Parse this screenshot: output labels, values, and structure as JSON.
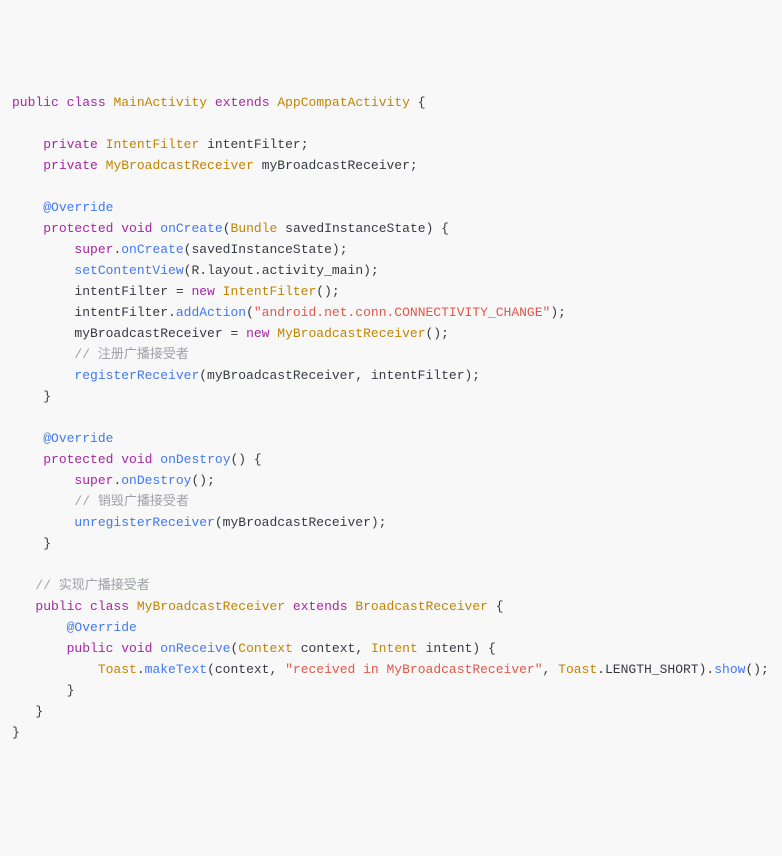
{
  "code": {
    "l01": {
      "kw1": "public",
      "kw2": "class",
      "cls": "MainActivity",
      "kw3": "extends",
      "sup": "AppCompatActivity",
      "br": "{"
    },
    "l02": "",
    "l03": {
      "kw": "private",
      "type": "IntentFilter",
      "var": "intentFilter;"
    },
    "l04": {
      "kw": "private",
      "type": "MyBroadcastReceiver",
      "var": "myBroadcastReceiver;"
    },
    "l05": "",
    "l06": {
      "ann": "@Override"
    },
    "l07": {
      "kw1": "protected",
      "kw2": "void",
      "m": "onCreate",
      "p1": "(",
      "type": "Bundle",
      "var": "savedInstanceState",
      "p2": ") {"
    },
    "l08": {
      "kw": "super",
      "dot": ".",
      "m": "onCreate",
      "rest": "(savedInstanceState);"
    },
    "l09": {
      "m": "setContentView",
      "p1": "(",
      "r": "R",
      "d1": ".",
      "lay": "layout",
      "d2": ".",
      "am": "activity_main",
      "p2": ");"
    },
    "l10": {
      "lhs": "intentFilter = ",
      "kw": "new",
      "type": "IntentFilter",
      "rest": "();"
    },
    "l11": {
      "obj": "intentFilter.",
      "m": "addAction",
      "p1": "(",
      "str": "\"android.net.conn.CONNECTIVITY_CHANGE\"",
      "p2": ");"
    },
    "l12": {
      "lhs": "myBroadcastReceiver = ",
      "kw": "new",
      "type": "MyBroadcastReceiver",
      "rest": "();"
    },
    "l13": {
      "c": "// 注册广播接受者"
    },
    "l14": {
      "m": "registerReceiver",
      "rest": "(myBroadcastReceiver, intentFilter);"
    },
    "l15": {
      "br": "}"
    },
    "l16": "",
    "l17": {
      "ann": "@Override"
    },
    "l18": {
      "kw1": "protected",
      "kw2": "void",
      "m": "onDestroy",
      "rest": "() {"
    },
    "l19": {
      "kw": "super",
      "dot": ".",
      "m": "onDestroy",
      "rest": "();"
    },
    "l20": {
      "c": "// 销毁广播接受者"
    },
    "l21": {
      "m": "unregisterReceiver",
      "rest": "(myBroadcastReceiver);"
    },
    "l22": {
      "br": "}"
    },
    "l23": "",
    "l24": {
      "c": "// 实现广播接受者"
    },
    "l25": {
      "kw1": "public",
      "kw2": "class",
      "cls": "MyBroadcastReceiver",
      "kw3": "extends",
      "sup": "BroadcastReceiver",
      "br": "{"
    },
    "l26": {
      "ann": "@Override"
    },
    "l27": {
      "kw1": "public",
      "kw2": "void",
      "m": "onReceive",
      "p1": "(",
      "t1": "Context",
      "v1": "context",
      "c": ", ",
      "t2": "Intent",
      "v2": "intent",
      "p2": ") {"
    },
    "l28": {
      "cls": "Toast",
      "d1": ".",
      "m1": "makeText",
      "p1": "(context, ",
      "str": "\"received in MyBroadcastReceiver\"",
      "c": ", ",
      "cls2": "Toast",
      "d2": ".",
      "con": "LENGTH_SHORT",
      "p2": ").",
      "m2": "show",
      "p3": "();"
    },
    "l29": {
      "br": "}"
    },
    "l30": {
      "br": "}"
    },
    "l31": {
      "br": "}"
    }
  }
}
